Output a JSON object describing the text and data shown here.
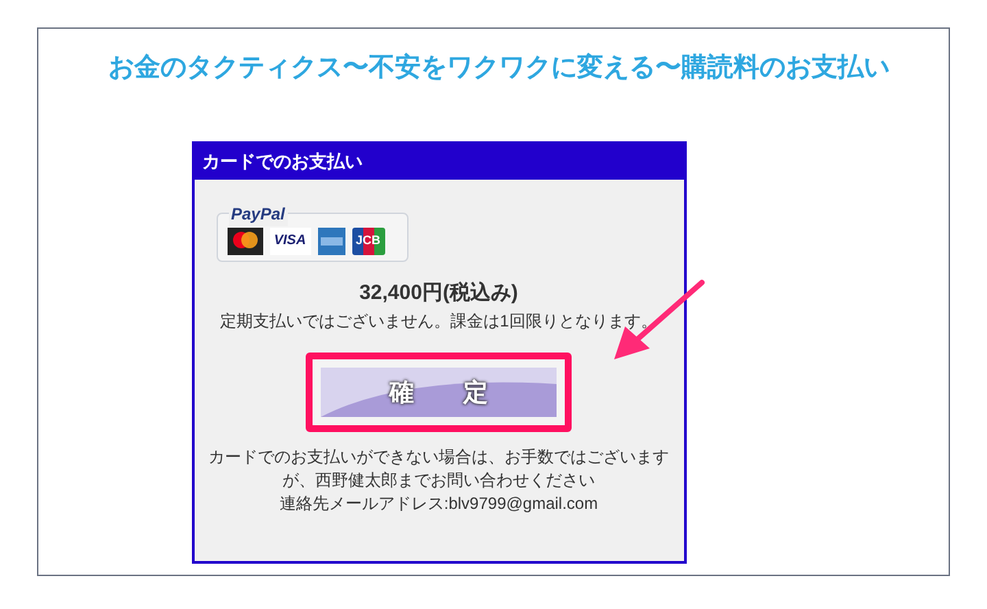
{
  "title": "お金のタクティクス〜不安をワクワクに変える〜購読料のお支払い",
  "card": {
    "header": "カードでのお支払い",
    "paypal": {
      "label": "PayPal",
      "cards": [
        {
          "kind": "mastercard"
        },
        {
          "kind": "visa",
          "label": "VISA"
        },
        {
          "kind": "amex"
        },
        {
          "kind": "jcb",
          "label": "JCB"
        }
      ]
    },
    "price": "32,400円(税込み)",
    "note": "定期支払いではございません。課金は1回限りとなります。",
    "confirm_button": "確　　定",
    "footer": "カードでのお支払いができない場合は、お手数ではございますが、西野健太郎までお問い合わせください",
    "contact": "連絡先メールアドレス:blv9799@gmail.com"
  }
}
